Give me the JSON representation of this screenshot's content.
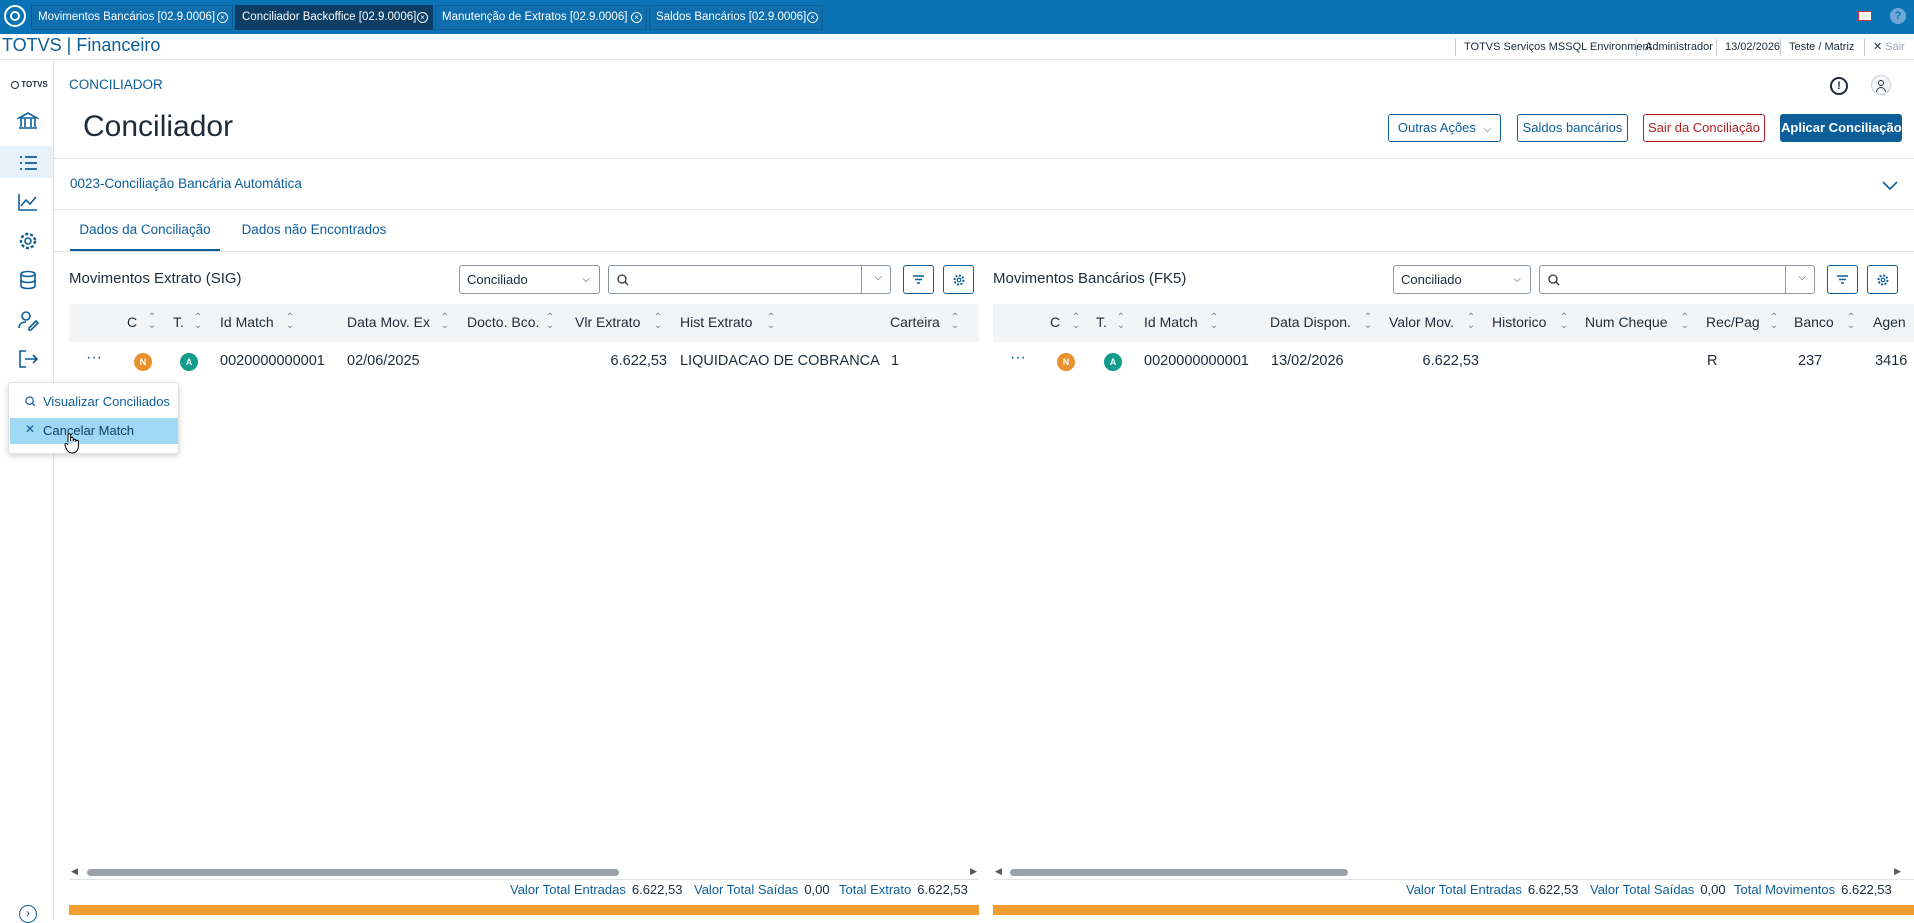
{
  "tabs": [
    {
      "label": "Movimentos Bancários [02.9.0006]",
      "close": "⊗"
    },
    {
      "label": "Conciliador Backoffice [02.9.0006]",
      "close": "⊗"
    },
    {
      "label": "Manutenção de Extratos [02.9.0006]",
      "close": "⊗"
    },
    {
      "label": "Saldos Bancários [02.9.0006]",
      "close": "⊗"
    }
  ],
  "app": {
    "title": "TOTVS | Financeiro"
  },
  "status_bar": {
    "environment": "TOTVS Serviços MSSQL Environment",
    "user": "Administrador",
    "date": "13/02/2026",
    "company": "Teste / Matriz",
    "exit_label": "Sair"
  },
  "sidebar": {
    "logo": "TOTVS",
    "icons": [
      "bank-icon",
      "list-icon",
      "chart-icon",
      "gear-icon",
      "database-icon",
      "user-edit-icon",
      "logout-icon",
      "chevron-right-icon"
    ]
  },
  "page": {
    "breadcrumb": "CONCILIADOR",
    "title": "Conciliador",
    "actions": {
      "more": "Outras Ações",
      "balances": "Saldos bancários",
      "exit": "Sair da Conciliação",
      "apply": "Aplicar Conciliação"
    },
    "config_name": "0023-Conciliação Bancária Automática",
    "tabs": [
      "Dados da Conciliação",
      "Dados não Encontrados"
    ]
  },
  "left_table": {
    "title": "Movimentos Extrato (SIG)",
    "filter": "Conciliado",
    "columns": [
      "C",
      "T.",
      "Id Match",
      "Data Mov. Ex",
      "Docto. Bco.",
      "Vlr Extrato",
      "Hist Extrato",
      "Carteira"
    ],
    "row": {
      "menu": "···",
      "c": "N",
      "t": "A",
      "id_match": "0020000000001",
      "data": "02/06/2025",
      "docto": "",
      "valor": "6.622,53",
      "hist": "LIQUIDACAO DE COBRANCA",
      "carteira": "1"
    },
    "totals": {
      "entradas_label": "Valor Total Entradas",
      "entradas": "6.622,53",
      "saidas_label": "Valor Total Saídas",
      "saidas": "0,00",
      "total_label": "Total Extrato",
      "total": "6.622,53"
    }
  },
  "right_table": {
    "title": "Movimentos Bancários (FK5)",
    "filter": "Conciliado",
    "columns": [
      "C",
      "T.",
      "Id Match",
      "Data Dispon.",
      "Valor Mov.",
      "Historico",
      "Num Cheque",
      "Rec/Pag",
      "Banco",
      "Agen"
    ],
    "row": {
      "menu": "···",
      "c": "N",
      "t": "A",
      "id_match": "0020000000001",
      "data": "13/02/2026",
      "valor": "6.622,53",
      "historico": "",
      "num_cheque": "",
      "rec_pag": "R",
      "banco": "237",
      "agencia": "3416"
    },
    "totals": {
      "entradas_label": "Valor Total Entradas",
      "entradas": "6.622,53",
      "saidas_label": "Valor Total Saídas",
      "saidas": "0,00",
      "total_label": "Total Movimentos",
      "total": "6.622,53"
    }
  },
  "context_menu": {
    "items": [
      {
        "icon": "search-icon",
        "label": "Visualizar Conciliados"
      },
      {
        "icon": "close-icon",
        "label": "Cancelar Match"
      }
    ]
  },
  "colors": {
    "brand": "#0a73b6",
    "accent": "#0c5e99",
    "badge_n": "#e8912d",
    "badge_a": "#139c8a",
    "progress": "#f39c2f",
    "danger": "#b32222"
  }
}
